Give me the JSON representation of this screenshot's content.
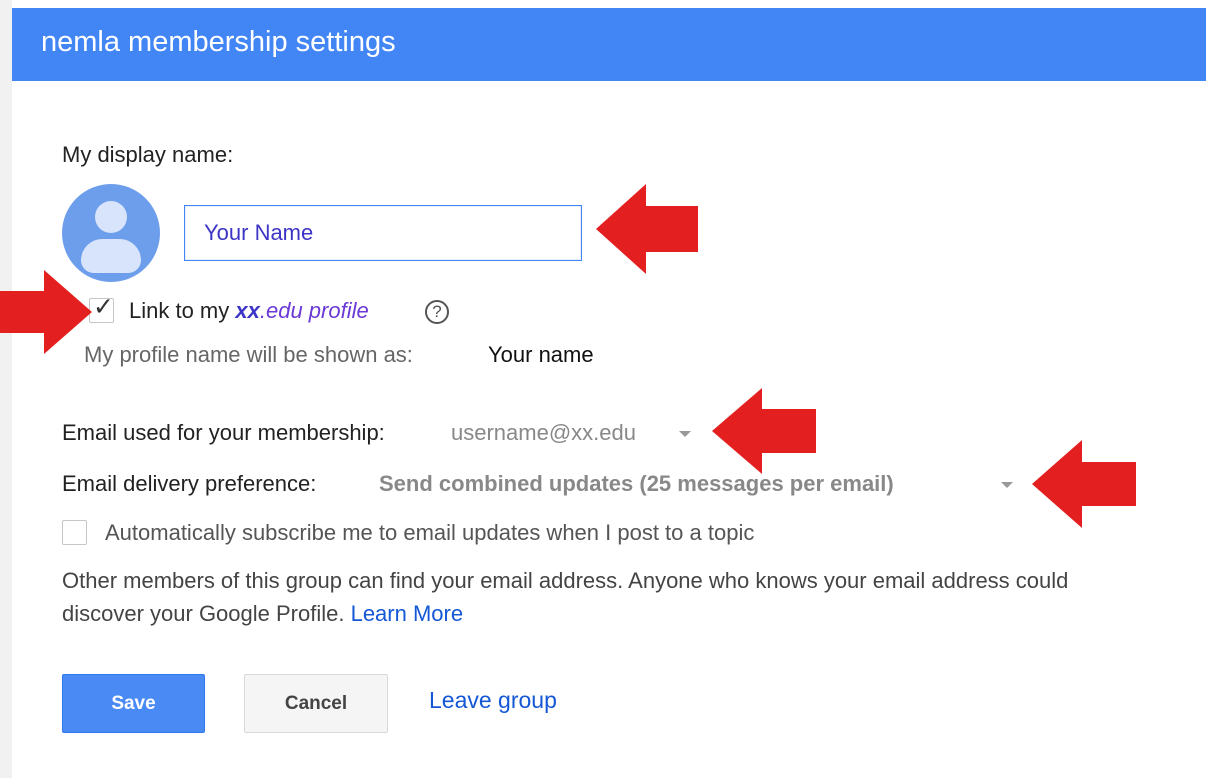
{
  "dialog": {
    "title": "nemla membership settings"
  },
  "display_name": {
    "label": "My display name:",
    "input_value": "Your Name"
  },
  "profile_link": {
    "checked": true,
    "prefix": "Link to my ",
    "domain_bold": "xx",
    "domain_suffix": ".edu profile",
    "help_icon": "?",
    "shown_as_label": "My profile name will be shown as:",
    "shown_as_value": "Your name"
  },
  "email": {
    "label": "Email used for your membership:",
    "value": "username@xx.edu"
  },
  "delivery": {
    "label": "Email delivery preference:",
    "value": "Send combined updates (25 messages per email)"
  },
  "auto_subscribe": {
    "checked": false,
    "label": "Automatically subscribe me to email updates when I post to a topic"
  },
  "privacy": {
    "text": "Other members of this group can find your email address. Anyone who knows your email address could discover your Google Profile. ",
    "learn_more": "Learn More"
  },
  "buttons": {
    "save": "Save",
    "cancel": "Cancel",
    "leave": "Leave group"
  },
  "colors": {
    "header": "#4285f4",
    "arrow": "#e3201f",
    "link": "#1558d6",
    "save_button": "#4a8af4"
  },
  "icons": {
    "avatar": "person-avatar-icon",
    "help": "help-circle-icon",
    "checkmark": "check-icon",
    "dropdown": "caret-down-icon",
    "annotation": "red-arrow-icon"
  }
}
